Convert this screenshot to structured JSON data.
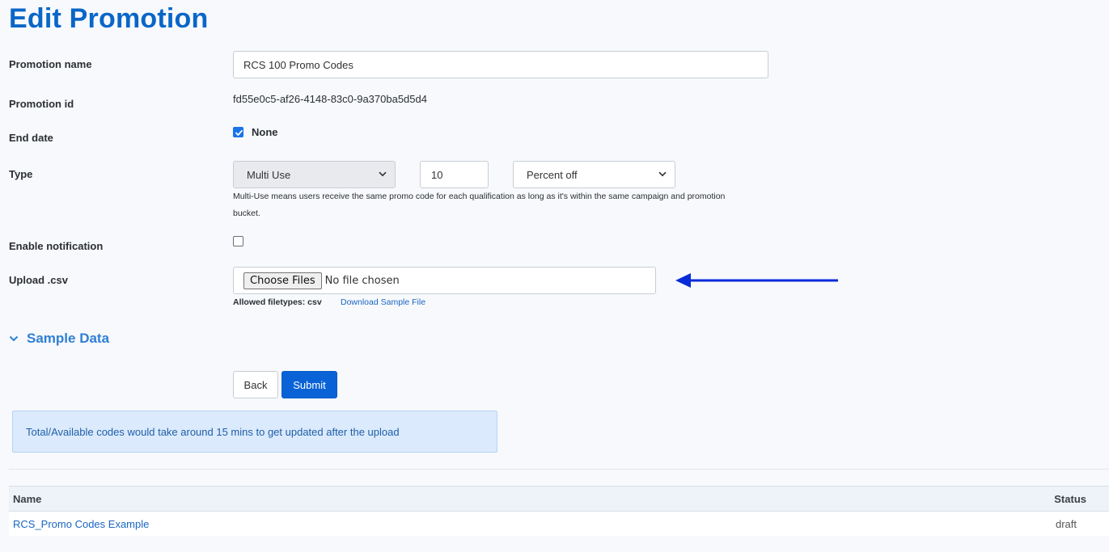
{
  "page": {
    "title": "Edit Promotion"
  },
  "form": {
    "promotion_name": {
      "label": "Promotion name",
      "value": "RCS 100 Promo Codes"
    },
    "promotion_id": {
      "label": "Promotion id",
      "value": "fd55e0c5-af26-4148-83c0-9a370ba5d5d4"
    },
    "end_date": {
      "label": "End date",
      "checkbox_label": "None",
      "checked": true
    },
    "type": {
      "label": "Type",
      "use_select": "Multi Use",
      "amount": "10",
      "discount_select": "Percent off",
      "helper": "Multi-Use means users receive the same promo code for each qualification as long as it's within the same campaign and promotion bucket."
    },
    "enable_notification": {
      "label": "Enable notification",
      "checked": false
    },
    "upload": {
      "label": "Upload .csv",
      "choose_button": "Choose Files",
      "no_file": "No file chosen",
      "allowed": "Allowed filetypes: csv",
      "download_link": "Download Sample File"
    }
  },
  "sample_data": {
    "label": "Sample Data"
  },
  "actions": {
    "back": "Back",
    "submit": "Submit"
  },
  "info": {
    "message": "Total/Available codes would take around 15 mins to get updated after the upload"
  },
  "table": {
    "headers": {
      "name": "Name",
      "status": "Status"
    },
    "rows": [
      {
        "name": "RCS_Promo Codes Example",
        "status": "draft"
      }
    ]
  },
  "colors": {
    "accent": "#0a66c8",
    "arrow": "#0a2bd9",
    "info_bg": "#dbeafc"
  },
  "icons": {
    "checkbox_checked": "check-icon",
    "chevron": "chevron-down-icon",
    "arrow": "left-arrow-icon"
  }
}
